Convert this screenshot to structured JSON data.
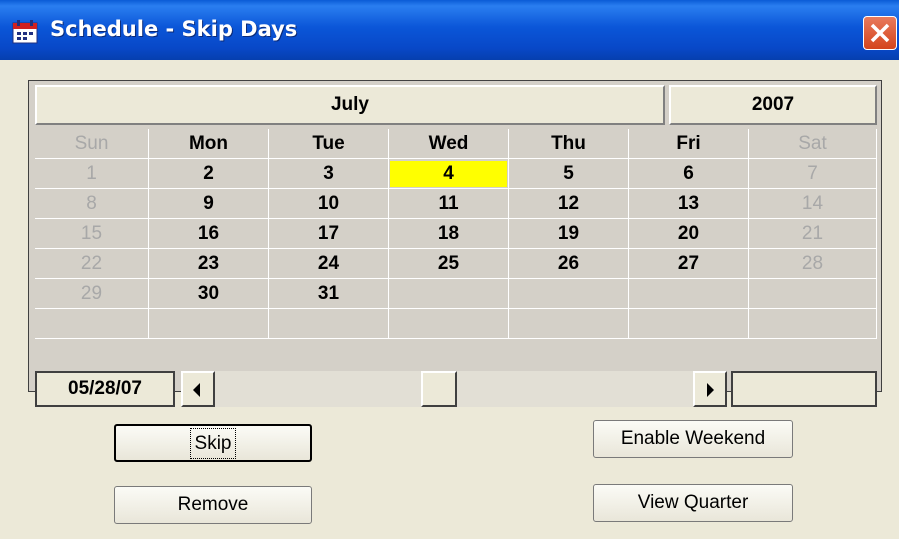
{
  "window": {
    "title": "Schedule - Skip Days"
  },
  "calendar": {
    "month": "July",
    "year": "2007",
    "weekdays": [
      {
        "label": "Sun",
        "muted": true
      },
      {
        "label": "Mon",
        "muted": false
      },
      {
        "label": "Tue",
        "muted": false
      },
      {
        "label": "Wed",
        "muted": false
      },
      {
        "label": "Thu",
        "muted": false
      },
      {
        "label": "Fri",
        "muted": false
      },
      {
        "label": "Sat",
        "muted": true
      }
    ],
    "weeks": [
      [
        "1",
        "2",
        "3",
        "4",
        "5",
        "6",
        "7"
      ],
      [
        "8",
        "9",
        "10",
        "11",
        "12",
        "13",
        "14"
      ],
      [
        "15",
        "16",
        "17",
        "18",
        "19",
        "20",
        "21"
      ],
      [
        "22",
        "23",
        "24",
        "25",
        "26",
        "27",
        "28"
      ],
      [
        "29",
        "30",
        "31",
        "",
        "",
        "",
        ""
      ],
      [
        "",
        "",
        "",
        "",
        "",
        "",
        ""
      ]
    ],
    "highlighted_day": "4",
    "highlight_color": "#ffff00",
    "muted_color": "#a8a8a8"
  },
  "date_display": "05/28/07",
  "buttons": {
    "skip": "Skip",
    "enable_weekend": "Enable Weekend",
    "remove": "Remove",
    "view_quarter": "View Quarter"
  },
  "colors": {
    "titlebar": "#0b56d8",
    "close": "#d4441c",
    "face": "#ece9d8"
  }
}
